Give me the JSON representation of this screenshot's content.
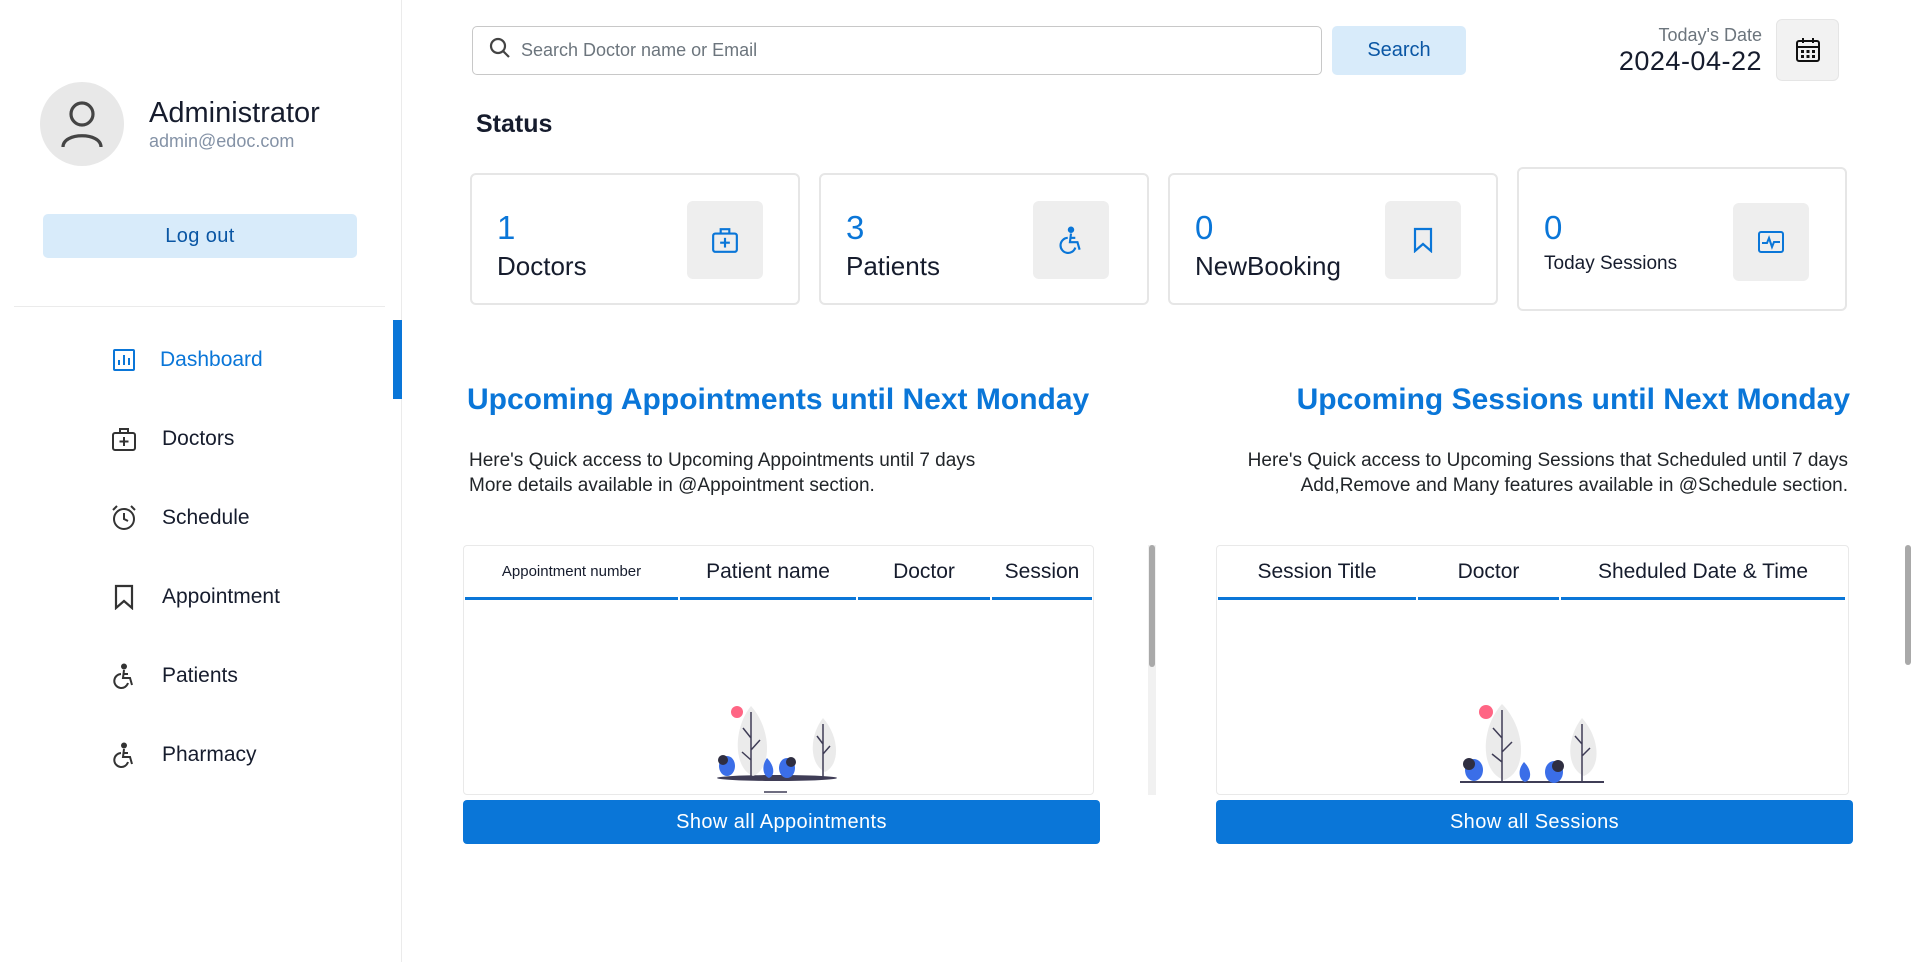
{
  "user": {
    "name": "Administrator",
    "email": "admin@edoc.com",
    "logout_label": "Log out"
  },
  "nav": {
    "items": [
      {
        "label": "Dashboard",
        "icon": "dashboard-icon"
      },
      {
        "label": "Doctors",
        "icon": "medical-bag-icon"
      },
      {
        "label": "Schedule",
        "icon": "alarm-clock-icon"
      },
      {
        "label": "Appointment",
        "icon": "bookmark-icon"
      },
      {
        "label": "Patients",
        "icon": "wheelchair-icon"
      },
      {
        "label": "Pharmacy",
        "icon": "wheelchair-icon"
      }
    ],
    "active": "Dashboard"
  },
  "search": {
    "placeholder": "Search Doctor name or Email",
    "button_label": "Search"
  },
  "date": {
    "label": "Today's Date",
    "value": "2024-04-22"
  },
  "status": {
    "heading": "Status",
    "cards": [
      {
        "count": "1",
        "label": "Doctors",
        "icon": "medical-bag-icon"
      },
      {
        "count": "3",
        "label": "Patients",
        "icon": "wheelchair-icon"
      },
      {
        "count": "0",
        "label": "NewBooking",
        "icon": "bookmark-icon"
      },
      {
        "count": "0",
        "label": "Today Sessions",
        "icon": "pulse-monitor-icon"
      }
    ]
  },
  "appointments": {
    "title": "Upcoming Appointments until Next Monday",
    "desc_line1": "Here's Quick access to Upcoming Appointments until 7 days",
    "desc_line2": "More details available in @Appointment section.",
    "columns": [
      "Appointment number",
      "Patient name",
      "Doctor",
      "Session"
    ],
    "button_label": "Show all Appointments"
  },
  "sessions": {
    "title": "Upcoming Sessions until Next Monday",
    "desc_line1": "Here's Quick access to Upcoming Sessions that Scheduled until 7 days",
    "desc_line2": "Add,Remove and Many features available in @Schedule section.",
    "columns": [
      "Session Title",
      "Doctor",
      "Sheduled Date & Time"
    ],
    "button_label": "Show all Sessions"
  },
  "colors": {
    "accent": "#0a76d8",
    "light_accent": "#d8ebfa"
  }
}
